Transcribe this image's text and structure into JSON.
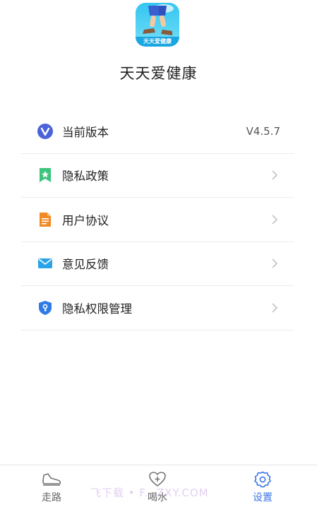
{
  "header": {
    "logo_text": "天天爱健康",
    "app_name": "天天爱健康"
  },
  "settings": {
    "items": [
      {
        "label": "当前版本",
        "value": "V4.5.7",
        "icon": "version-v-icon"
      },
      {
        "label": "隐私政策",
        "icon": "privacy-policy-icon"
      },
      {
        "label": "用户协议",
        "icon": "user-agreement-doc-icon"
      },
      {
        "label": "意见反馈",
        "icon": "feedback-mail-icon"
      },
      {
        "label": "隐私权限管理",
        "icon": "permission-shield-icon"
      }
    ]
  },
  "tabbar": {
    "tabs": [
      {
        "label": "走路",
        "icon": "shoe-icon",
        "active": false
      },
      {
        "label": "喝水",
        "icon": "heart-plus-icon",
        "active": false
      },
      {
        "label": "设置",
        "icon": "gear-icon",
        "active": true
      }
    ]
  },
  "watermark": "飞下载 • F...ZXY.COM",
  "colors": {
    "accent": "#3a76e8",
    "version_icon": "#4a63d9",
    "privacy_icon": "#3cc47c",
    "agreement_icon": "#f08a24",
    "feedback_icon": "#2aa4e8",
    "permission_icon": "#2f7be6"
  }
}
